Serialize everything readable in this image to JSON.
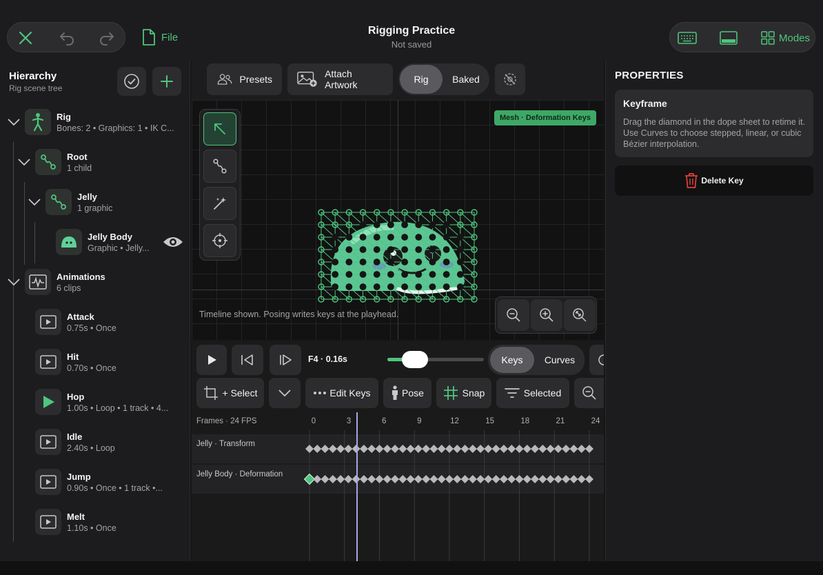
{
  "header": {
    "file_label": "File",
    "title": "Rigging Practice",
    "subtitle": "Not saved",
    "modes_label": "Modes"
  },
  "hierarchy": {
    "title": "Hierarchy",
    "subtitle": "Rig scene tree",
    "nodes": [
      {
        "title": "Rig",
        "sub": "Bones: 2 • Graphics: 1 • IK C..."
      },
      {
        "title": "Root",
        "sub": "1 child"
      },
      {
        "title": "Jelly",
        "sub": "1 graphic"
      },
      {
        "title": "Jelly Body",
        "sub": "Graphic • Jelly..."
      },
      {
        "title": "Animations",
        "sub": "6 clips"
      }
    ],
    "clips": [
      {
        "title": "Attack",
        "sub": "0.75s • Once"
      },
      {
        "title": "Hit",
        "sub": "0.70s • Once"
      },
      {
        "title": "Hop",
        "sub": "1.00s • Loop • 1 track • 4..."
      },
      {
        "title": "Idle",
        "sub": "2.40s • Loop"
      },
      {
        "title": "Jump",
        "sub": "0.90s • Once • 1 track •..."
      },
      {
        "title": "Melt",
        "sub": "1.10s • Once"
      }
    ]
  },
  "toolbar": {
    "presets": "Presets",
    "attach_artwork": "Attach Artwork",
    "rig": "Rig",
    "baked": "Baked"
  },
  "canvas": {
    "badge": "Mesh · Deformation Keys",
    "hint": "Timeline shown. Posing writes keys at the playhead."
  },
  "timeline": {
    "frame_label": "F4 · 0.16s",
    "playhead_fraction": 0.17,
    "keys": "Keys",
    "curves": "Curves",
    "select": "+ Select",
    "edit_keys": "Edit Keys",
    "pose": "Pose",
    "snap": "Snap",
    "selected": "Selected",
    "fps_label": "Frames · 24 FPS",
    "ticks": [
      "0",
      "3",
      "6",
      "9",
      "12",
      "15",
      "18",
      "21",
      "24"
    ],
    "tracks": [
      {
        "name": "Jelly · Transform"
      },
      {
        "name": "Jelly Body · Deformation"
      }
    ]
  },
  "properties": {
    "title": "PROPERTIES",
    "card_title": "Keyframe",
    "card_body": "Drag the diamond in the dope sheet to retime it. Use Curves to choose stepped, linear, or cubic Bézier interpolation.",
    "delete_label": "Delete Key"
  },
  "colors": {
    "accent": "#4fc57d",
    "delete": "#e0413a"
  }
}
